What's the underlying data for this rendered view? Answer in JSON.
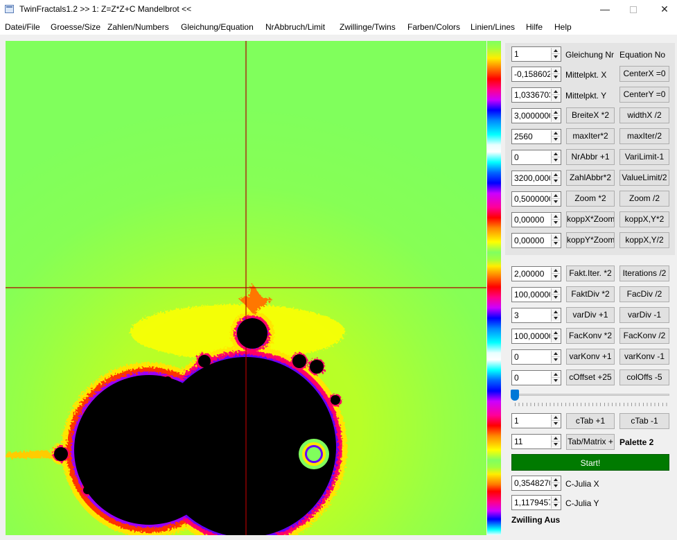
{
  "window": {
    "title": "TwinFractals1.2 >> 1: Z=Z*Z+C Mandelbrot <<",
    "minimize": "—",
    "close": "✕"
  },
  "menu": [
    "Datei/File",
    "Groesse/Size",
    "Zahlen/Numbers",
    "Gleichung/Equation",
    "NrAbbruch/Limit",
    "Zwillinge/Twins",
    "Farben/Colors",
    "Linien/Lines",
    "Hilfe",
    "Help"
  ],
  "controls": {
    "equation": {
      "value": "1",
      "label_de": "Gleichung Nr",
      "label_en": "Equation No"
    },
    "center_x": {
      "value": "-0,158602(",
      "label": "Mittelpkt. X",
      "button": "CenterX =0"
    },
    "center_y": {
      "value": "1,0336703(",
      "label": "Mittelpkt. Y",
      "button": "CenterY =0"
    },
    "width": {
      "value": "3,0000000",
      "btn_mul": "BreiteX *2",
      "btn_div": "widthX /2"
    },
    "max_iter": {
      "value": "2560",
      "btn_mul": "maxIter*2",
      "btn_div": "maxIter/2"
    },
    "nr_abbr": {
      "value": "0",
      "btn_inc": "NrAbbr +1",
      "btn_dec": "VariLimit-1"
    },
    "zahl_abbr": {
      "value": "3200,0000",
      "btn_mul": "ZahlAbbr*2",
      "btn_div": "ValueLimit/2"
    },
    "zoom": {
      "value": "0,5000000",
      "btn_mul": "Zoom *2",
      "btn_div": "Zoom /2"
    },
    "kopp_x": {
      "value": "0,00000",
      "btn_mul": "koppX*Zoom",
      "btn_div": "koppX,Y*2"
    },
    "kopp_y": {
      "value": "0,00000",
      "btn_mul": "koppY*Zoom",
      "btn_div": "koppX,Y/2"
    },
    "fakt_iter": {
      "value": "2,00000",
      "btn_mul": "Fakt.Iter. *2",
      "btn_div": "Iterations /2"
    },
    "fakt_div": {
      "value": "100,00000",
      "btn_mul": "FaktDiv *2",
      "btn_div": "FacDiv /2"
    },
    "var_div": {
      "value": "3",
      "btn_inc": "varDiv +1",
      "btn_dec": "varDiv -1"
    },
    "fac_konv": {
      "value": "100,00000",
      "btn_mul": "FacKonv *2",
      "btn_div": "FacKonv /2"
    },
    "var_konv": {
      "value": "0",
      "btn_inc": "varKonv +1",
      "btn_dec": "varKonv -1"
    },
    "c_offset": {
      "value": "0",
      "btn_inc": "cOffset +25",
      "btn_dec": "colOffs -5"
    },
    "c_tab": {
      "value": "1",
      "btn_inc": "cTab +1",
      "btn_dec": "cTab -1"
    },
    "tab_matrix": {
      "value": "11",
      "button": "Tab/Matrix +",
      "palette_label": "Palette 2"
    },
    "start_label": "Start!",
    "julia_x": {
      "value": "0,3548270",
      "label": "C-Julia X"
    },
    "julia_y": {
      "value": "1,1179457",
      "label": "C-Julia Y"
    },
    "twin_status": "Zwilling Aus",
    "slider_value": 0
  },
  "colors": {
    "start_button": "#007a00",
    "crosshair": "#b00000",
    "fractal_background": "#80ff5c",
    "set_interior": "#000000"
  }
}
